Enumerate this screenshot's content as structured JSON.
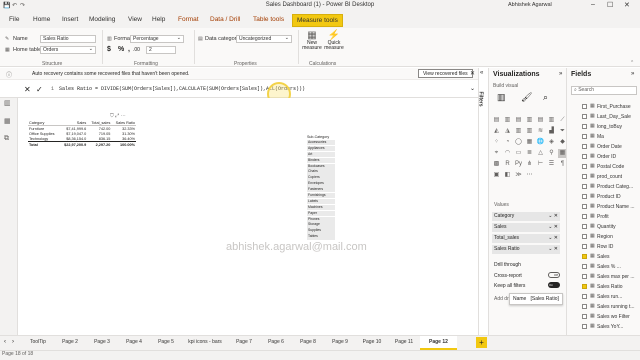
{
  "app": {
    "window_title": "Sales Dashboard (1) - Power BI Desktop",
    "user": "Abhishek Agarwal"
  },
  "ribbon_tabs": [
    "File",
    "Home",
    "Insert",
    "Modeling",
    "View",
    "Help",
    "Format",
    "Data / Drill",
    "Table tools",
    "Measure tools"
  ],
  "ribbon": {
    "structure": {
      "name_label": "Name",
      "name_value": "Sales Ratio",
      "home_table_label": "Home table",
      "home_table_value": "Orders",
      "group_label": "Structure"
    },
    "formatting": {
      "format_label": "Format",
      "format_value": "Percentage",
      "symbols": [
        "$",
        "%",
        ",",
        ".00"
      ],
      "decimals": "2",
      "group_label": "Formatting"
    },
    "properties": {
      "category_label": "Data category",
      "category_value": "Uncategorized",
      "group_label": "Properties"
    },
    "calculations": {
      "new_measure": "New measure",
      "quick_measure": "Quick measure",
      "group_label": "Calculations"
    }
  },
  "notification": {
    "text": "Auto recovery contains some recovered files that haven't been opened.",
    "button": "View recovered files"
  },
  "formula": {
    "line_number": "1",
    "text": "Sales Ratio = DIVIDE(SUM(Orders[Sales]),CALCULATE(SUM(Orders[Sales]),ALL(Orders)))"
  },
  "table_visual": {
    "headers": [
      "Category",
      "Sales",
      "Total_sales",
      "Sales Ratio"
    ],
    "rows": [
      [
        "Furniture",
        "$7,41,999.6",
        "742.00",
        "32.33%"
      ],
      [
        "Office Supplies",
        "$7,19,047.0",
        "719.05",
        "31.30%"
      ],
      [
        "Technology",
        "$8,36,154.0",
        "836.15",
        "36.40%"
      ]
    ],
    "total": [
      "Total",
      "$22,97,200.9",
      "2,297.20",
      "100.00%"
    ]
  },
  "slicer": {
    "header": "Sub-Category",
    "items": [
      "Accessories",
      "Appliances",
      "Art",
      "Binders",
      "Bookcases",
      "Chairs",
      "Copiers",
      "Envelopes",
      "Fasteners",
      "Furnishings",
      "Labels",
      "Machines",
      "Paper",
      "Phones",
      "Storage",
      "Supplies",
      "Tables"
    ]
  },
  "watermark": "abhishek.agarwal@mail.com",
  "filters_label": "Filters",
  "visualizations": {
    "title": "Visualizations",
    "build_visual": "Build visual",
    "values_label": "Values",
    "wells": [
      "Category",
      "Sales",
      "Total_sales",
      "Sales Ratio"
    ],
    "drill_through": "Drill through",
    "cross_report": "Cross-report",
    "cross_report_state": "Off",
    "keep_all_filters": "Keep all filters",
    "keep_all_filters_state": "On",
    "add_drill": "Add dr",
    "tooltip_name_label": "Name",
    "tooltip_name_value": "[Sales Ratio]"
  },
  "fields": {
    "title": "Fields",
    "search_placeholder": "Search",
    "items": [
      {
        "label": "First_Purchase",
        "checked": false
      },
      {
        "label": "Last_Day_Sale",
        "checked": false
      },
      {
        "label": "long_toBuy",
        "checked": false
      },
      {
        "label": "Ma",
        "checked": false
      },
      {
        "label": "Order Date",
        "checked": false
      },
      {
        "label": "Order ID",
        "checked": false
      },
      {
        "label": "Postal Code",
        "checked": false
      },
      {
        "label": "prod_count",
        "checked": false
      },
      {
        "label": "Product Categ...",
        "checked": false
      },
      {
        "label": "Product ID",
        "checked": false
      },
      {
        "label": "Product Name ...",
        "checked": false
      },
      {
        "label": "Profit",
        "checked": false
      },
      {
        "label": "Quantity",
        "checked": false
      },
      {
        "label": "Region",
        "checked": false
      },
      {
        "label": "Row ID",
        "checked": false
      },
      {
        "label": "Sales",
        "checked": true
      },
      {
        "label": "Sales % ...",
        "checked": false
      },
      {
        "label": "Sales max per ...",
        "checked": false
      },
      {
        "label": "Sales Ratio",
        "checked": true
      },
      {
        "label": "Sales run...",
        "checked": false
      },
      {
        "label": "Sales running t...",
        "checked": false
      },
      {
        "label": "Sales wo Filter",
        "checked": false
      },
      {
        "label": "Sales YoY...",
        "checked": false
      }
    ]
  },
  "pages": [
    "ToolTip",
    "Page 2",
    "Page 3",
    "Page 4",
    "Page 5",
    "kpi icons - bars",
    "Page 7",
    "Page 6",
    "Page 8",
    "Page 9",
    "Page 10",
    "Page 11",
    "Page 12"
  ],
  "active_page": "Page 12",
  "status": "Page 18 of 18"
}
